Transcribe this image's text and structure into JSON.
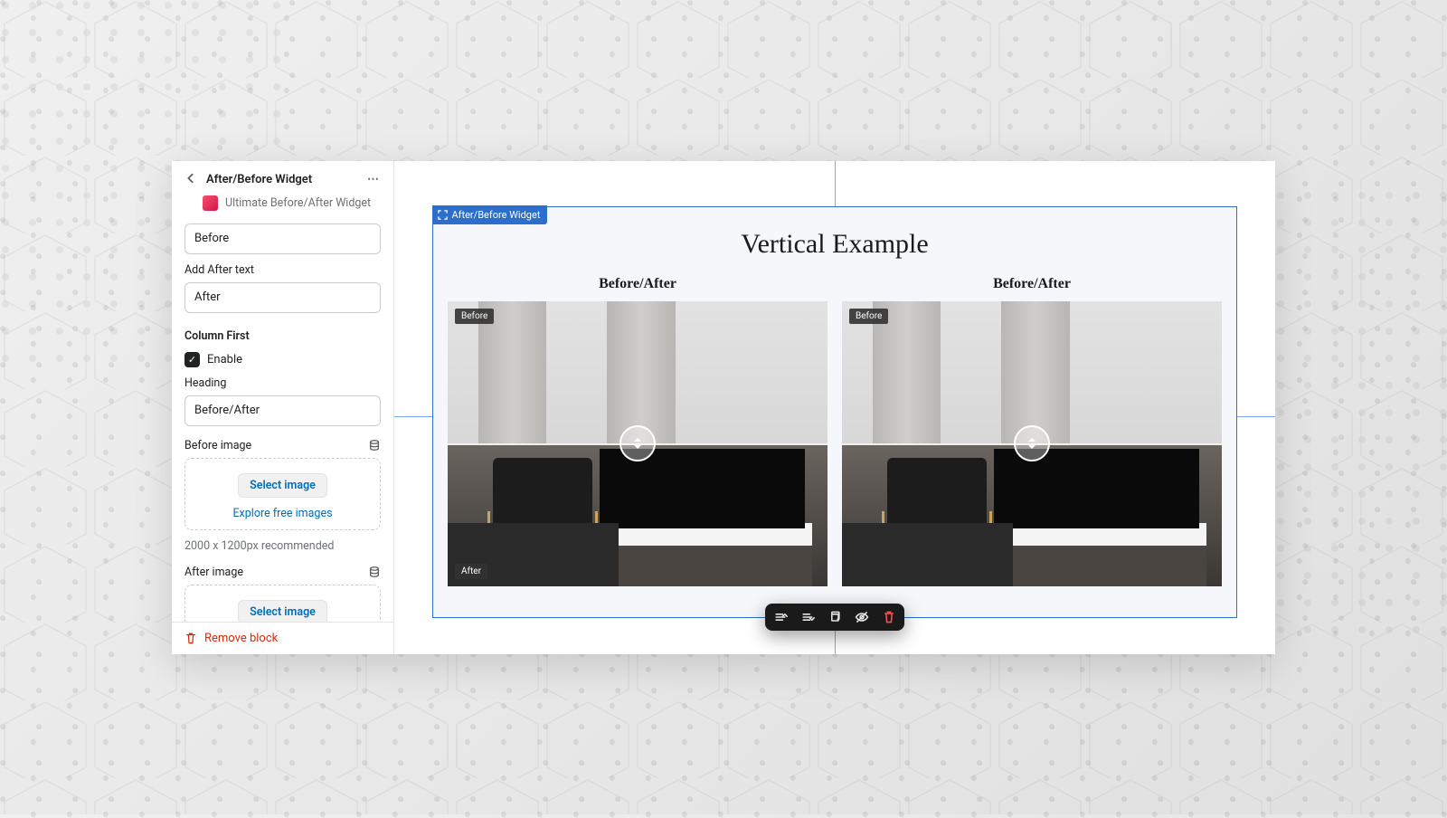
{
  "sidebar": {
    "title": "After/Before Widget",
    "subtitle": "Ultimate Before/After Widget",
    "before_input_value": "Before",
    "after_label": "Add After text",
    "after_input_value": "After",
    "column_first_heading": "Column First",
    "enable_label": "Enable",
    "enable_checked": true,
    "heading_label": "Heading",
    "heading_input_value": "Before/After",
    "before_image_label": "Before image",
    "after_image_label": "After image",
    "select_image_btn": "Select image",
    "explore_link": "Explore free images",
    "recommended_text": "2000 x 1200px recommended",
    "remove_block": "Remove block"
  },
  "preview": {
    "block_tag": "After/Before Widget",
    "title": "Vertical Example",
    "col_heading": "Before/After",
    "before_badge": "Before",
    "after_badge": "After"
  }
}
